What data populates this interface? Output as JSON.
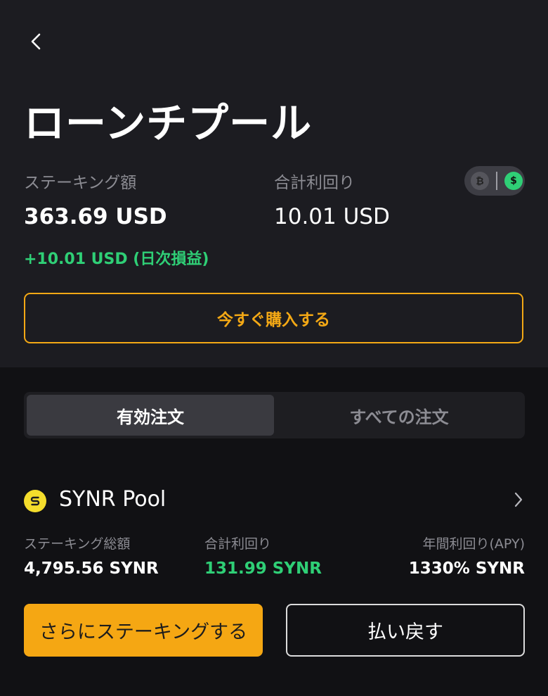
{
  "header": {
    "title": "ローンチプール"
  },
  "summary": {
    "staking_label": "ステーキング額",
    "staking_value": "363.69 USD",
    "yield_label": "合計利回り",
    "yield_value": "10.01 USD",
    "daily_pnl": "+10.01 USD (日次損益)",
    "currency_toggle": {
      "btc_symbol": "₿",
      "usd_symbol": "$"
    },
    "buy_label": "今すぐ購入する"
  },
  "tabs": [
    {
      "label": "有効注文",
      "active": true
    },
    {
      "label": "すべての注文",
      "active": false
    }
  ],
  "pool": {
    "name": "SYNR Pool",
    "total_staking_label": "ステーキング総額",
    "total_staking_value": "4,795.56 SYNR",
    "total_yield_label": "合計利回り",
    "total_yield_value": "131.99 SYNR",
    "apy_label": "年間利回り(APY)",
    "apy_value": "1330% SYNR",
    "stake_more_label": "さらにステーキングする",
    "redeem_label": "払い戻す"
  },
  "colors": {
    "accent": "#f3a815",
    "positive": "#2fcf76",
    "background": "#111114",
    "panel": "#1c1c21"
  }
}
